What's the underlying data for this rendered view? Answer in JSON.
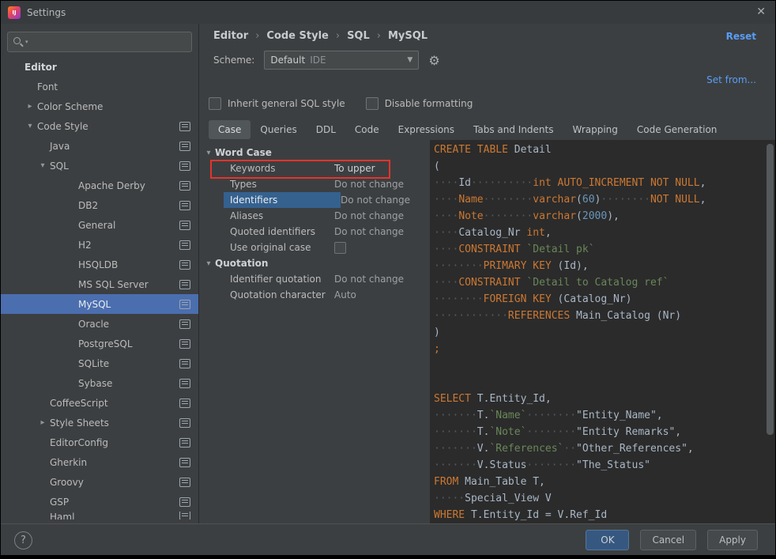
{
  "window": {
    "title": "Settings",
    "logo_text": "IJ",
    "close_icon": "✕"
  },
  "sidebar": {
    "search": {
      "placeholder": ""
    },
    "items": [
      {
        "label": "Editor",
        "level": 0,
        "bold": true
      },
      {
        "label": "Font",
        "level": 1
      },
      {
        "label": "Color Scheme",
        "level": 1,
        "arrow": "collapsed"
      },
      {
        "label": "Code Style",
        "level": 1,
        "arrow": "expanded",
        "icon": true
      },
      {
        "label": "Java",
        "level": 2,
        "icon": true
      },
      {
        "label": "SQL",
        "level": 2,
        "arrow": "expanded",
        "icon": true
      },
      {
        "label": "Apache Derby",
        "level": 3,
        "icon": true
      },
      {
        "label": "DB2",
        "level": 3,
        "icon": true
      },
      {
        "label": "General",
        "level": 3,
        "icon": true
      },
      {
        "label": "H2",
        "level": 3,
        "icon": true
      },
      {
        "label": "HSQLDB",
        "level": 3,
        "icon": true
      },
      {
        "label": "MS SQL Server",
        "level": 3,
        "icon": true
      },
      {
        "label": "MySQL",
        "level": 3,
        "icon": true,
        "selected": true
      },
      {
        "label": "Oracle",
        "level": 3,
        "icon": true
      },
      {
        "label": "PostgreSQL",
        "level": 3,
        "icon": true
      },
      {
        "label": "SQLite",
        "level": 3,
        "icon": true
      },
      {
        "label": "Sybase",
        "level": 3,
        "icon": true
      },
      {
        "label": "CoffeeScript",
        "level": 2,
        "icon": true
      },
      {
        "label": "Style Sheets",
        "level": 2,
        "arrow": "collapsed",
        "icon": true
      },
      {
        "label": "EditorConfig",
        "level": 2,
        "icon": true
      },
      {
        "label": "Gherkin",
        "level": 2,
        "icon": true
      },
      {
        "label": "Groovy",
        "level": 2,
        "icon": true
      },
      {
        "label": "GSP",
        "level": 2,
        "icon": true
      },
      {
        "label": "Haml",
        "level": 2,
        "icon": true,
        "partial": true
      }
    ]
  },
  "breadcrumb": {
    "items": [
      "Editor",
      "Code Style",
      "SQL",
      "MySQL"
    ],
    "separator": "›"
  },
  "links": {
    "reset": "Reset",
    "set_from": "Set from..."
  },
  "scheme": {
    "label": "Scheme:",
    "value": "Default",
    "value_suffix": "IDE"
  },
  "checkboxes": [
    {
      "label": "Inherit general SQL style",
      "checked": false
    },
    {
      "label": "Disable formatting",
      "checked": false
    }
  ],
  "tabs": [
    {
      "label": "Case",
      "selected": true
    },
    {
      "label": "Queries"
    },
    {
      "label": "DDL"
    },
    {
      "label": "Code"
    },
    {
      "label": "Expressions"
    },
    {
      "label": "Tabs and Indents"
    },
    {
      "label": "Wrapping"
    },
    {
      "label": "Code Generation"
    }
  ],
  "options": {
    "groups": [
      {
        "title": "Word Case",
        "rows": [
          {
            "label": "Keywords",
            "value": "To upper",
            "annotated": true,
            "bright": true
          },
          {
            "label": "Types",
            "value": "Do not change"
          },
          {
            "label": "Identifiers",
            "value": "Do not change",
            "selected": true
          },
          {
            "label": "Aliases",
            "value": "Do not change"
          },
          {
            "label": "Quoted identifiers",
            "value": "Do not change"
          },
          {
            "label": "Use original case",
            "checkbox": true,
            "checked": false
          }
        ]
      },
      {
        "title": "Quotation",
        "rows": [
          {
            "label": "Identifier quotation",
            "value": "Do not change"
          },
          {
            "label": "Quotation character",
            "value": "Auto"
          }
        ]
      }
    ]
  },
  "code": {
    "lines": [
      [
        [
          "k",
          "CREATE TABLE"
        ],
        [
          "i",
          " Detail"
        ]
      ],
      [
        [
          "i",
          "("
        ]
      ],
      [
        [
          "d",
          "····"
        ],
        [
          "i",
          "Id"
        ],
        [
          "d",
          "··········"
        ],
        [
          "k",
          "int AUTO_INCREMENT NOT NULL"
        ],
        [
          "i",
          ","
        ]
      ],
      [
        [
          "d",
          "····"
        ],
        [
          "k",
          "Name"
        ],
        [
          "d",
          "········"
        ],
        [
          "k",
          "varchar"
        ],
        [
          "i",
          "("
        ],
        [
          "n",
          "60"
        ],
        [
          "i",
          ")"
        ],
        [
          "d",
          "········"
        ],
        [
          "k",
          "NOT NULL"
        ],
        [
          "i",
          ","
        ]
      ],
      [
        [
          "d",
          "····"
        ],
        [
          "k",
          "Note"
        ],
        [
          "d",
          "········"
        ],
        [
          "k",
          "varchar"
        ],
        [
          "i",
          "("
        ],
        [
          "n",
          "2000"
        ],
        [
          "i",
          "),"
        ]
      ],
      [
        [
          "d",
          "····"
        ],
        [
          "i",
          "Catalog_Nr "
        ],
        [
          "k",
          "int"
        ],
        [
          "i",
          ","
        ]
      ],
      [
        [
          "d",
          "····"
        ],
        [
          "k",
          "CONSTRAINT"
        ],
        [
          "i",
          " "
        ],
        [
          "q",
          "`Detail pk`"
        ]
      ],
      [
        [
          "d",
          "········"
        ],
        [
          "k",
          "PRIMARY KEY"
        ],
        [
          "i",
          " (Id),"
        ]
      ],
      [
        [
          "d",
          "····"
        ],
        [
          "k",
          "CONSTRAINT"
        ],
        [
          "i",
          " "
        ],
        [
          "q",
          "`Detail to Catalog ref`"
        ]
      ],
      [
        [
          "d",
          "········"
        ],
        [
          "k",
          "FOREIGN KEY"
        ],
        [
          "i",
          " (Catalog_Nr)"
        ]
      ],
      [
        [
          "d",
          "············"
        ],
        [
          "k",
          "REFERENCES"
        ],
        [
          "i",
          " Main_Catalog (Nr)"
        ]
      ],
      [
        [
          "i",
          ")"
        ]
      ],
      [
        [
          "k",
          ";"
        ]
      ],
      [],
      [],
      [
        [
          "k",
          "SELECT"
        ],
        [
          "i",
          " T.Entity_Id,"
        ]
      ],
      [
        [
          "d",
          "·······"
        ],
        [
          "i",
          "T."
        ],
        [
          "q",
          "`Name`"
        ],
        [
          "d",
          "········"
        ],
        [
          "s",
          "\"Entity_Name\""
        ],
        [
          "i",
          ","
        ]
      ],
      [
        [
          "d",
          "·······"
        ],
        [
          "i",
          "T."
        ],
        [
          "q",
          "`Note`"
        ],
        [
          "d",
          "········"
        ],
        [
          "s",
          "\"Entity Remarks\""
        ],
        [
          "i",
          ","
        ]
      ],
      [
        [
          "d",
          "·······"
        ],
        [
          "i",
          "V."
        ],
        [
          "q",
          "`References`"
        ],
        [
          "d",
          "··"
        ],
        [
          "s",
          "\"Other_References\""
        ],
        [
          "i",
          ","
        ]
      ],
      [
        [
          "d",
          "·······"
        ],
        [
          "i",
          "V.Status"
        ],
        [
          "d",
          "········"
        ],
        [
          "s",
          "\"The_Status\""
        ]
      ],
      [
        [
          "k",
          "FROM"
        ],
        [
          "i",
          " Main_Table T,"
        ]
      ],
      [
        [
          "d",
          "·····"
        ],
        [
          "i",
          "Special_View V"
        ]
      ],
      [
        [
          "k",
          "WHERE"
        ],
        [
          "i",
          " T.Entity_Id = V.Ref_Id"
        ]
      ]
    ]
  },
  "buttons": {
    "ok": "OK",
    "cancel": "Cancel",
    "apply": "Apply",
    "help": "?"
  }
}
